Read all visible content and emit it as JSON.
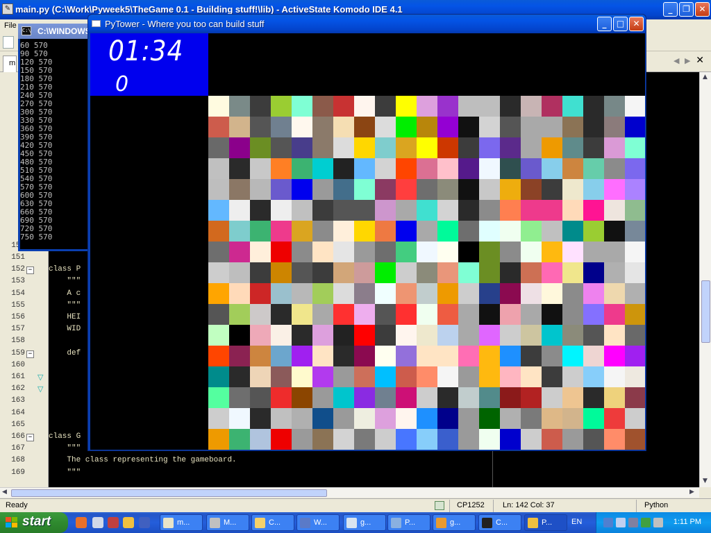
{
  "komodo": {
    "title": "main.py (C:\\Work\\Pyweek5\\TheGame 0.1 - Building stuff!\\lib) - ActiveState Komodo IDE 4.1",
    "menu_first": "File",
    "tab_first": "m",
    "close_tab": "✕",
    "nav_prev": "◀",
    "nav_next": "▶"
  },
  "window_buttons": {
    "minimize": "_",
    "maximize": "□",
    "restore": "❐",
    "close": "✕"
  },
  "console": {
    "title": "C:\\WINDOWS\\system32\\cmd.exe",
    "icon_text": "C:\\",
    "output": "60 570\n90 570\n120 570\n150 570\n180 570\n210 570\n240 570\n270 570\n300 570\n330 570\n360 570\n390 570\n420 570\n450 570\n480 570\n510 570\n540 570\n570 570\n600 570\n630 570\n660 570\n690 570\n720 570\n750 570"
  },
  "editor": {
    "lines": [
      {
        "num": "1",
        "code": ""
      },
      {
        "num": "1",
        "code": ""
      },
      {
        "num": "1",
        "code": ""
      },
      {
        "num": "1",
        "code": ""
      },
      {
        "num": "1",
        "code": ""
      },
      {
        "num": "1",
        "code": ""
      },
      {
        "num": "1",
        "code": ""
      },
      {
        "num": "1",
        "code": ""
      },
      {
        "num": "1",
        "code": ""
      },
      {
        "num": "1",
        "code": ""
      },
      {
        "num": "1",
        "code": ""
      },
      {
        "num": "1",
        "code": ""
      },
      {
        "num": "1",
        "code": ""
      },
      {
        "num": "1",
        "code": ""
      },
      {
        "num": "150",
        "code": ""
      },
      {
        "num": "151",
        "code": ""
      },
      {
        "num": "152",
        "code": "class P"
      },
      {
        "num": "153",
        "code": "    \"\"\""
      },
      {
        "num": "154",
        "code": "    A c"
      },
      {
        "num": "155",
        "code": "    \"\"\""
      },
      {
        "num": "156",
        "code": "    HEI"
      },
      {
        "num": "157",
        "code": "    WID"
      },
      {
        "num": "158",
        "code": ""
      },
      {
        "num": "159",
        "code": "    def"
      },
      {
        "num": "160",
        "code": ""
      },
      {
        "num": "161",
        "code": ""
      },
      {
        "num": "162",
        "code": ""
      },
      {
        "num": "163",
        "code": ""
      },
      {
        "num": "164",
        "code": ""
      },
      {
        "num": "165",
        "code": ""
      },
      {
        "num": "166",
        "code": "class G"
      },
      {
        "num": "167",
        "code": "    \"\"\""
      },
      {
        "num": "168",
        "code": "    The class representing the gameboard."
      },
      {
        "num": "169",
        "code": "    \"\"\""
      }
    ]
  },
  "statusbar": {
    "ready": "Ready",
    "encoding": "CP1252",
    "position": "Ln: 142 Col: 37",
    "language": "Python"
  },
  "pytower": {
    "title": "PyTower - Where you too can build stuff",
    "timer": "01:34",
    "score": "0"
  },
  "board": {
    "cols": 21,
    "rows": 17,
    "colors": [
      "#fffbe0",
      "#7a8a88",
      "#3c3c3c",
      "#9acd32",
      "#7fffd4",
      "#8b5a4a",
      "#c83232",
      "#fff5ee",
      "#3c3c3c",
      "#ffff00",
      "#dda0dd",
      "#9932cc",
      "#bebebe",
      "#bebebe",
      "#2a2a2a",
      "#c8b4b4",
      "#b03060",
      "#40e0d0",
      "#2a2a2a",
      "#778888",
      "#f5f5f5",
      "#cd5c4c",
      "#d2b48c",
      "#555555",
      "#708090",
      "#fff8ee",
      "#8b7a6a",
      "#f5deb3",
      "#8b4513",
      "#dcdcdc",
      "#00ee00",
      "#b8860b",
      "#9400d3",
      "#111111",
      "#d3d3d3",
      "#555555",
      "#a9a9a9",
      "#a9a9a9",
      "#8b7355",
      "#2a2a2a",
      "#8b7b7b",
      "#0000cd",
      "#696969",
      "#8b008b",
      "#6b8e23",
      "#555555",
      "#483d8b",
      "#8b7a6a",
      "#dcdcdc",
      "#ffd700",
      "#7fcdcd",
      "#daa520",
      "#ffff00",
      "#cd3700",
      "#3c3c3c",
      "#7b68ee",
      "#5b2a8b",
      "#a9a9a9",
      "#ee9a00",
      "#5f8b8b",
      "#3c3c3c",
      "#da9ad6",
      "#7fffd4",
      "#c0c0c0",
      "#2a2a2a",
      "#c8c8c8",
      "#ff7f24",
      "#3cb371",
      "#00ced1",
      "#222222",
      "#63b8ff",
      "#d3d3d3",
      "#ff4500",
      "#db7093",
      "#ffc0cb",
      "#551a8b",
      "#f0f8ff",
      "#2f4f4f",
      "#6a5acd",
      "#87ceeb",
      "#cd853f",
      "#66cdaa",
      "#8b8b8b",
      "#7b68ee",
      "#bebebe",
      "#8b7765",
      "#b8b8b8",
      "#6a5acd",
      "#0000ee",
      "#9a9a9a",
      "#436e8b",
      "#7fffd4",
      "#8b3a62",
      "#ff3e3e",
      "#6e6e6e",
      "#8b8b7a",
      "#111111",
      "#c8c8c8",
      "#eead0e",
      "#8b4226",
      "#3c3c3c",
      "#eee8cd",
      "#87ceeb",
      "#ff6eff",
      "#ab82ff",
      "#63b8ff",
      "#eeeeee",
      "#2a2a2a",
      "#eeeeee",
      "#c0c0c0",
      "#3c3c3c",
      "#555555",
      "#555555",
      "#cd96cd",
      "#a9a9a9",
      "#40e0d0",
      "#d3d3d3",
      "#2a2a2a",
      "#8b8b8b",
      "#ff7f50",
      "#ee3a8c",
      "#ee3a8c",
      "#ffdab9",
      "#ff1493",
      "#eee5de",
      "#8fbc8f",
      "#d2691e",
      "#7ecdcd",
      "#3cb371",
      "#ee3a8c",
      "#daa520",
      "#8b8b8b",
      "#ffefdb",
      "#ffd700",
      "#ee7942",
      "#0000ee",
      "#a9a9a9",
      "#00fa9a",
      "#6e6e6e",
      "#e0ffff",
      "#f0fff0",
      "#90ee90",
      "#c0c0c0",
      "#008b8b",
      "#9acd32",
      "#111111",
      "#778899",
      "#6e6e6e",
      "#cd2990",
      "#ffefdb",
      "#ee0000",
      "#8b8b8b",
      "#ffe4c4",
      "#e5e5e5",
      "#9a9a9a",
      "#6e6e6e",
      "#43cd80",
      "#f0f8ff",
      "#fffff0",
      "#000000",
      "#6b8e23",
      "#8b8b8b",
      "#f0fff0",
      "#ffb90f",
      "#ffe1ff",
      "#a9a9a9",
      "#a9a9a9",
      "#f5f5f5",
      "#cdcdcd",
      "#bebebe",
      "#3c3c3c",
      "#cd8500",
      "#555555",
      "#3c3c3c",
      "#d2a679",
      "#cd9b9b",
      "#00ee00",
      "#cdcdcd",
      "#8b8b7a",
      "#e9967a",
      "#7fffd4",
      "#6b8e23",
      "#2a2a2a",
      "#cd7054",
      "#ff69b4",
      "#f0e68c",
      "#00008b",
      "#b0b0b0",
      "#e5e5e5",
      "#ffa500",
      "#ffdab9",
      "#cd2626",
      "#9ac0cd",
      "#b8b8b8",
      "#a2cd5a",
      "#dcdcdc",
      "#8b7d8b",
      "#f0ffff",
      "#ee9572",
      "#c1cdcd",
      "#ee9a00",
      "#cdcdcd",
      "#27408b",
      "#8b0a50",
      "#eee0e5",
      "#fff8dc",
      "#8b8b8b",
      "#ee82ee",
      "#eed8ae",
      "#b0b0b0",
      "#555555",
      "#a2cd5a",
      "#cdc9c9",
      "#2a2a2a",
      "#f0e68c",
      "#a9a9a9",
      "#ff3030",
      "#eeaeee",
      "#555555",
      "#ff3030",
      "#f0fff0",
      "#ee5c42",
      "#a9a9a9",
      "#111111",
      "#eea2ad",
      "#a9a9a9",
      "#111111",
      "#8b8b8b",
      "#8470ff",
      "#ee3a8c",
      "#cd950c",
      "#c1ffc1",
      "#000000",
      "#eea9b8",
      "#faf0e6",
      "#2a2a2a",
      "#dda0dd",
      "#222222",
      "#ff0000",
      "#3c3c3c",
      "#fff5ee",
      "#eee8cd",
      "#bcd2ee",
      "#a9a9a9",
      "#e066ff",
      "#cdcdcd",
      "#cdc5a0",
      "#00c5cd",
      "#8b8b7a",
      "#555555",
      "#ffe4c4",
      "#696969",
      "#ff4500",
      "#8b2252",
      "#cd853f",
      "#6ca6cd",
      "#a020f0",
      "#ffe4c4",
      "#2a2a2a",
      "#8b0a50",
      "#fffff0",
      "#9370db",
      "#ffe4c4",
      "#ffe4c4",
      "#ff6eb4",
      "#ffb90f",
      "#1e90ff",
      "#3c3c3c",
      "#8b8b8b",
      "#00f5ff",
      "#eed5d2",
      "#ff00ff",
      "#a020f0",
      "#008b8b",
      "#2a2a2a",
      "#eed5b7",
      "#8b5a5a",
      "#fffacd",
      "#b23aee",
      "#9a9a9a",
      "#cd6f5a",
      "#00bfff",
      "#cd5c4c",
      "#ff8c69",
      "#f5f5f5",
      "#9a9a9a",
      "#ffb90f",
      "#ffb6c1",
      "#ffe4c4",
      "#3c3c3c",
      "#cdcdcd",
      "#87cefa",
      "#f5f5f5",
      "#eee9e0",
      "#54ff9f",
      "#6e6e6e",
      "#555555",
      "#ee2c2c",
      "#8b4500",
      "#9a9a9a",
      "#00c5cd",
      "#8a2be2",
      "#708090",
      "#cd1076",
      "#cdcdcd",
      "#2a2a2a",
      "#c1cdcd",
      "#528b8b",
      "#8b1a1a",
      "#b22222",
      "#cdcdcd",
      "#eec591",
      "#2a2a2a",
      "#eed27c",
      "#8b3a4a",
      "#cdcdcd",
      "#f0f8ff",
      "#2a2a2a",
      "#c0c0c0",
      "#b0b0b0",
      "#104e8b",
      "#9a9a9a",
      "#eeeee0",
      "#dda0dd",
      "#fff5ee",
      "#1e90ff",
      "#00008b",
      "#9a9a9a",
      "#006400",
      "#b0b0b0",
      "#7a7a7a",
      "#deb887",
      "#d2b48c",
      "#00fa9a",
      "#ee3b3b",
      "#cdcdcd",
      "#ee9a00",
      "#3cb371",
      "#b0c4de",
      "#ee0000",
      "#9a9a9a",
      "#8b7355",
      "#d3d3d3",
      "#7a7a7a",
      "#cdcdcd",
      "#4876ff",
      "#87cefa",
      "#3a5fcd",
      "#9a9a9a",
      "#f0fff0",
      "#0000cd",
      "#cdcdcd",
      "#cd5c4c",
      "#9a9a9a",
      "#555555",
      "#ff8c69",
      "#a0522d"
    ]
  },
  "taskbar": {
    "start": "start",
    "tasks": [
      {
        "label": "m...",
        "color": "#e8e4c8"
      },
      {
        "label": "M...",
        "color": "#c0c0c0"
      },
      {
        "label": "C...",
        "color": "#f5d16a"
      },
      {
        "label": "W...",
        "color": "#5a7ac8"
      },
      {
        "label": "g...",
        "color": "#d8e4f0"
      },
      {
        "label": "P...",
        "color": "#8ab0e0"
      },
      {
        "label": "g...",
        "color": "#e89a30"
      },
      {
        "label": "C...",
        "color": "#222222"
      },
      {
        "label": "P...",
        "color": "#f0c040"
      }
    ],
    "lang": "EN",
    "clock": "1:11 PM"
  }
}
